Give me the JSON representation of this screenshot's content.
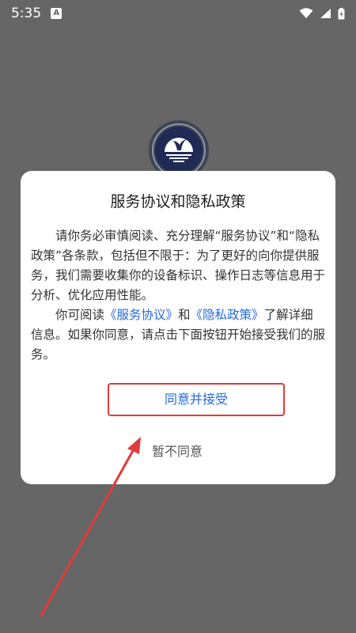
{
  "status_bar": {
    "time": "5:35",
    "notification_badge": "A",
    "icons": [
      "wifi-icon",
      "signal-icon",
      "battery-charging-icon"
    ]
  },
  "background": {
    "color": "#666666",
    "logo_icon": "whale-tail-sunset-logo"
  },
  "dialog": {
    "title": "服务协议和隐私政策",
    "paragraph1": "请你务必审慎阅读、充分理解“服务协议”和“隐私政策”各条款，包括但不限于：为了更好的向你提供服务，我们需要收集你的设备标识、操作日志等信息用于分析、优化应用性能。",
    "paragraph2_prefix": "你可阅读",
    "service_agreement_link": "《服务协议》",
    "paragraph2_and": "和",
    "privacy_policy_link": "《隐私政策》",
    "paragraph2_suffix": "了解详细信息。如果你同意，请点击下面按钮开始接受我们的服务。",
    "accept_label": "同意并接受",
    "decline_label": "暂不同意"
  },
  "colors": {
    "link": "#2468e0",
    "highlight_border": "#e23a3a",
    "arrow": "#e23a3a"
  }
}
